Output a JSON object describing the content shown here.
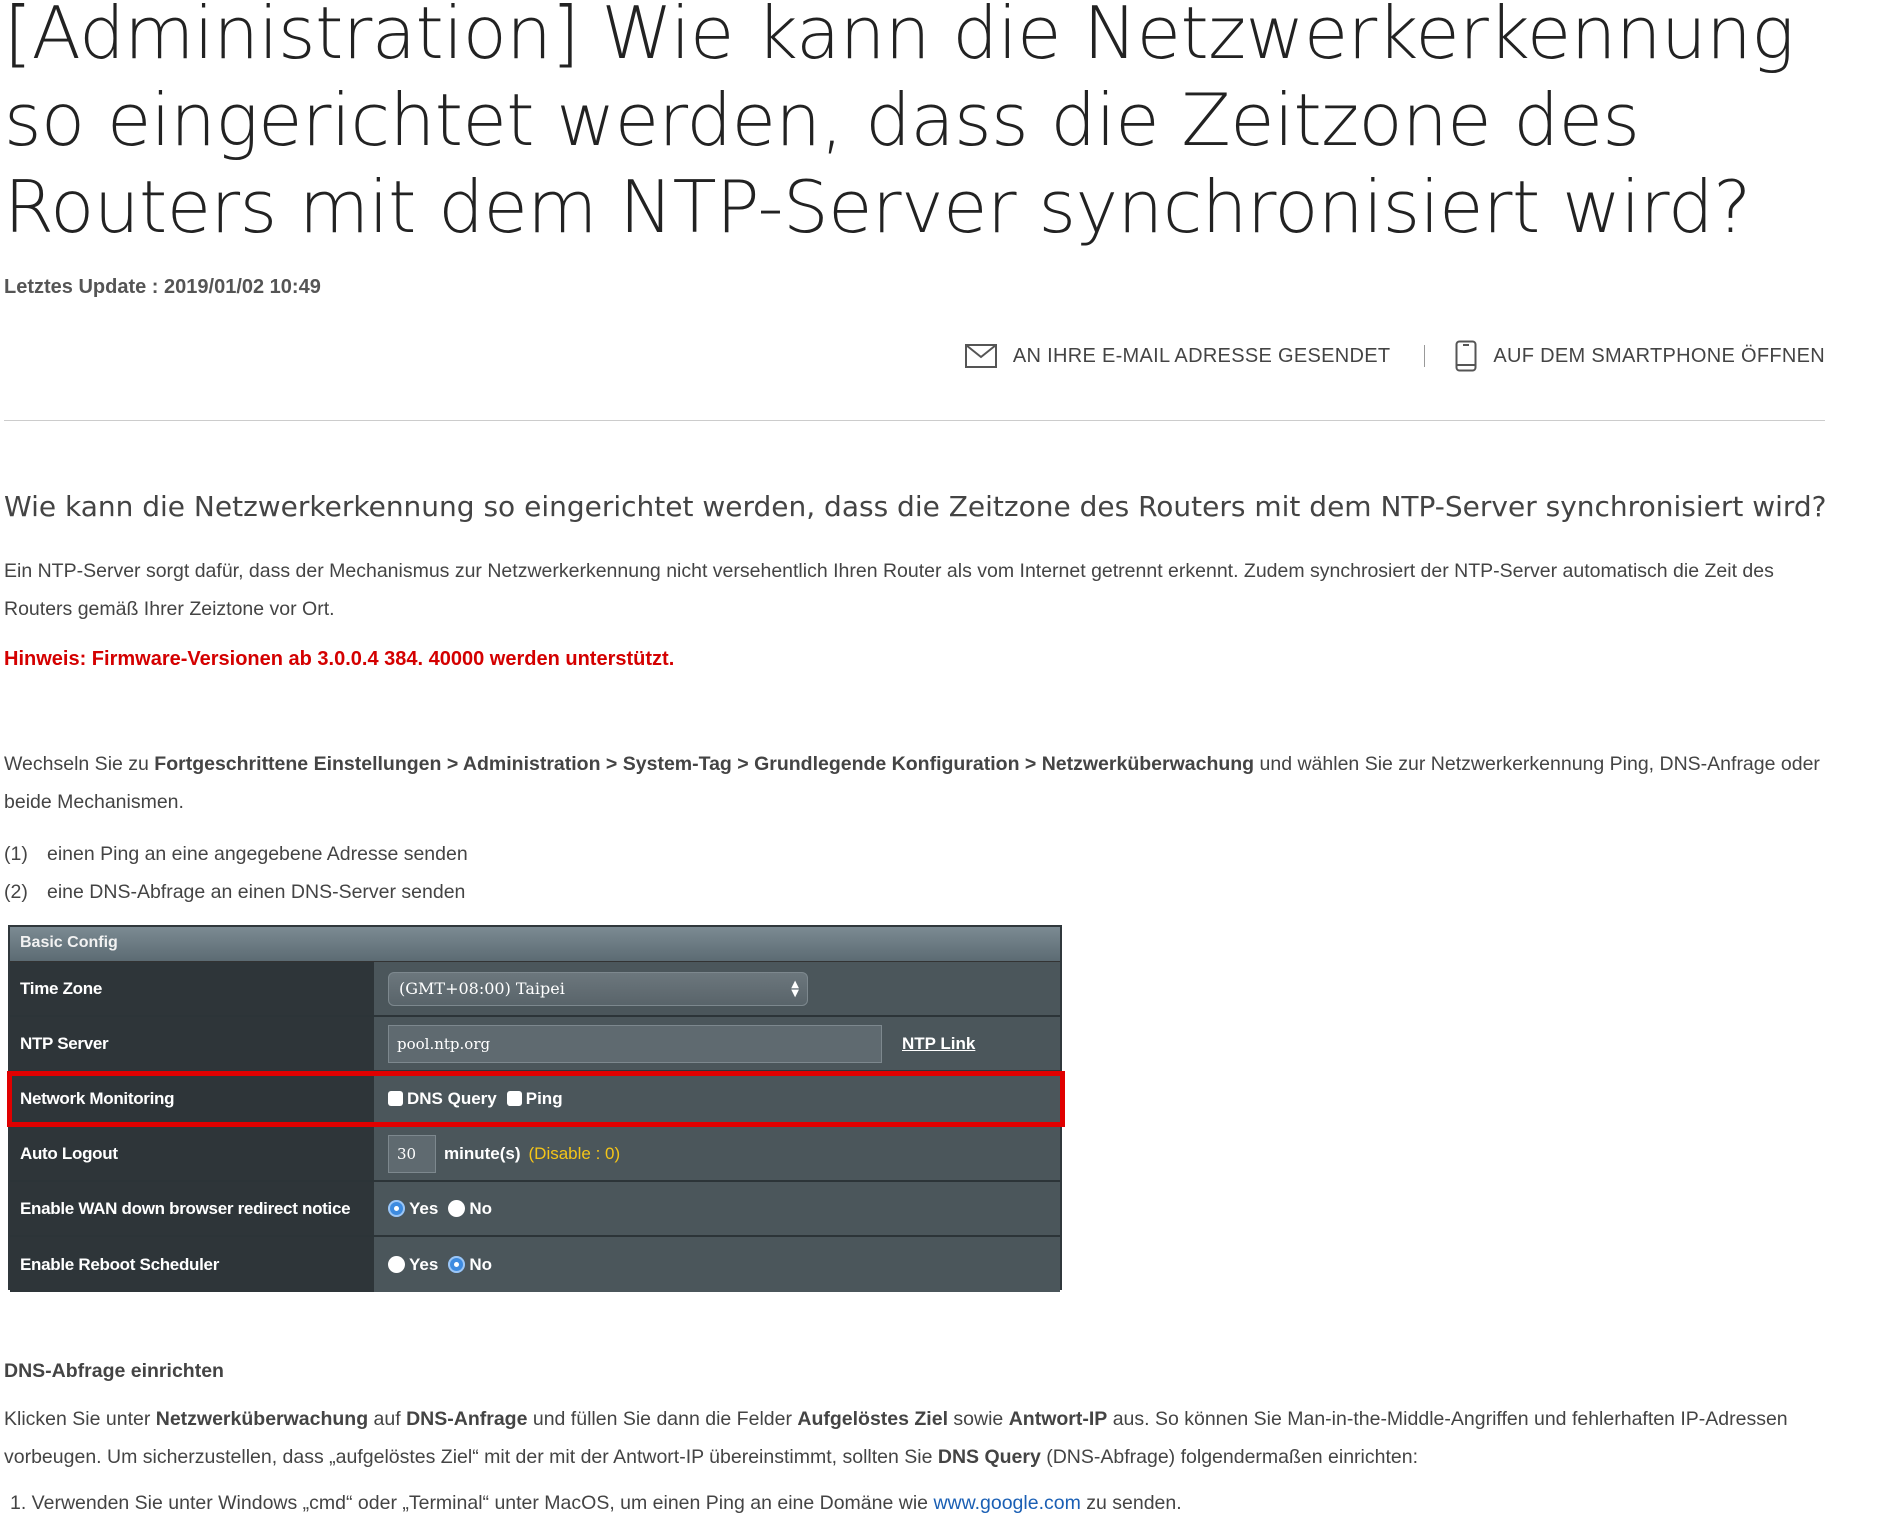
{
  "article": {
    "title": "[Administration] Wie kann die Netzwerkerkennung so eingerichtet werden, dass die Zeitzone des Routers mit dem NTP-Server synchronisiert wird?",
    "updated_label": "Letztes Update : ",
    "updated_value": "2019/01/02 10:49"
  },
  "share": {
    "email_label": "AN IHRE E-MAIL ADRESSE GESENDET",
    "email_icon": "envelope-icon",
    "phone_label": "AUF DEM SMARTPHONE ÖFFNEN",
    "phone_icon": "smartphone-icon"
  },
  "content": {
    "subtitle": "Wie kann die Netzwerkerkennung so eingerichtet werden, dass die Zeitzone des Routers mit dem NTP-Server synchronisiert wird?",
    "intro": "Ein NTP-Server sorgt dafür, dass der Mechanismus zur Netzwerkerkennung nicht versehentlich Ihren Router als vom Internet getrennt erkennt. Zudem synchrosiert der NTP-Server automatisch die Zeit des Routers gemäß Ihrer Zeiztone vor Ort.",
    "note": "Hinweis: Firmware-Versionen ab 3.0.0.4 384. 40000 werden unterstützt.",
    "steps_prefix": "Wechseln Sie zu ",
    "path_1": "Fortgeschrittene Einstellungen",
    "sep": " > ",
    "path_2": "Administration",
    "path_3": "System-Tag",
    "path_4": "Grundlegende Konfiguration",
    "path_5": "Netzwerküberwachung",
    "steps_suffix": " und wählen Sie zur Netzwerkerkennung Ping, DNS-Anfrage oder beide Mechanismen.",
    "list": [
      {
        "num": "(1)",
        "text": "einen Ping an eine angegebene Adresse senden"
      },
      {
        "num": "(2)",
        "text": "eine DNS-Abfrage an einen DNS-Server senden"
      }
    ],
    "dns_heading": "DNS-Abfrage einrichten",
    "dns_p_1": "Klicken Sie unter ",
    "dns_b_1": "Netzwerküberwachung",
    "dns_p_2": " auf ",
    "dns_b_2": "DNS-Anfrage",
    "dns_p_3": " und füllen Sie dann die Felder ",
    "dns_b_3": "Aufgelöstes Ziel",
    "dns_p_4": " sowie ",
    "dns_b_4": "Antwort-IP",
    "dns_p_5": " aus. So können Sie Man-in-the-Middle-Angriffen und fehlerhaften IP-Adressen vorbeugen. Um sicherzustellen, dass „aufgelöstes Ziel“ mit der mit der Antwort-IP übereinstimmt, sollten Sie ",
    "dns_b_5": "DNS Query",
    "dns_p_6": " (DNS-Abfrage) folgendermaßen einrichten:",
    "step1_pre": "1. Verwenden Sie unter Windows „cmd“ oder „Terminal“ unter MacOS, um einen Ping an eine Domäne wie ",
    "step1_link": "www.google.com",
    "step1_post": " zu senden."
  },
  "panel": {
    "header": "Basic Config",
    "time_zone_label": "Time Zone",
    "time_zone_value": "(GMT+08:00) Taipei",
    "ntp_label": "NTP Server",
    "ntp_value": "pool.ntp.org",
    "ntp_link": "NTP Link",
    "monitor_label": "Network Monitoring",
    "monitor_dns": "DNS Query",
    "monitor_ping": "Ping",
    "logout_label": "Auto Logout",
    "logout_value": "30",
    "logout_unit": "minute(s)",
    "logout_hint": "(Disable : 0)",
    "wan_label": "Enable WAN down browser redirect notice",
    "reboot_label": "Enable Reboot Scheduler",
    "yes": "Yes",
    "no": "No",
    "wan_selected": "Yes",
    "reboot_selected": "No",
    "highlight_color": "#e00000"
  }
}
